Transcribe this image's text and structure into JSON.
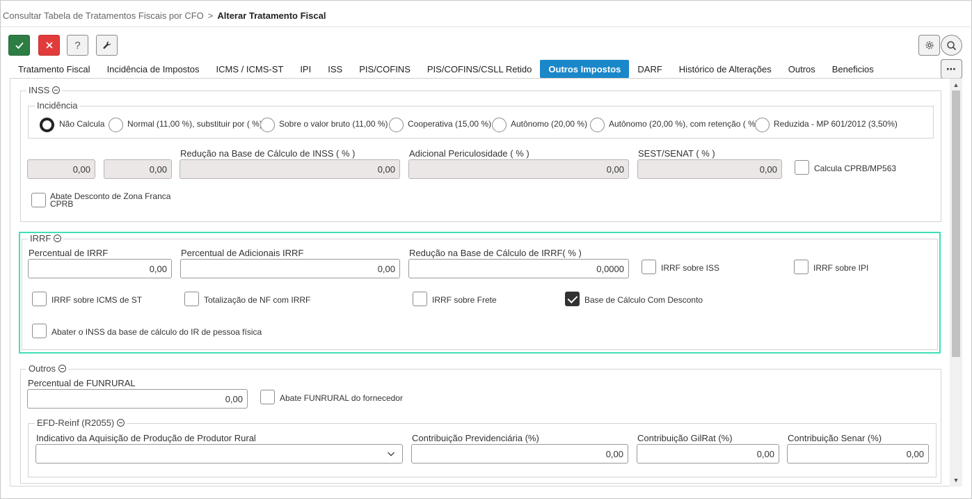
{
  "breadcrumb": {
    "parent": "Consultar Tabela de Tratamentos Fiscais por CFO",
    "separator": ">",
    "current": "Alterar Tratamento Fiscal"
  },
  "toolbar": {
    "help_label": "?",
    "more_label": "⋯"
  },
  "tabs": [
    {
      "label": "Tratamento Fiscal"
    },
    {
      "label": "Incidência de Impostos"
    },
    {
      "label": "ICMS / ICMS-ST"
    },
    {
      "label": "IPI"
    },
    {
      "label": "ISS"
    },
    {
      "label": "PIS/COFINS"
    },
    {
      "label": "PIS/COFINS/CSLL Retido"
    },
    {
      "label": "Outros Impostos",
      "active": true
    },
    {
      "label": "DARF"
    },
    {
      "label": "Histórico de Alterações"
    },
    {
      "label": "Outros"
    },
    {
      "label": "Beneficios"
    }
  ],
  "inss": {
    "legend": "INSS",
    "incidencia": {
      "legend": "Incidência",
      "options": [
        {
          "label": "Não Calcula",
          "selected": true
        },
        {
          "label": "Normal (11,00 %), substituir por ( %)"
        },
        {
          "label": "Sobre o valor bruto (11,00 %)"
        },
        {
          "label": "Cooperativa (15,00 %)"
        },
        {
          "label": "Autônomo (20,00 %)"
        },
        {
          "label": "Autônomo (20,00 %), com retenção ( %)"
        },
        {
          "label": "Reduzida - MP 601/2012 (3,50%)"
        }
      ]
    },
    "field1_value": "0,00",
    "field2_value": "0,00",
    "reducao_label": "Redução na Base de Cálculo de INSS ( % )",
    "reducao_value": "0,00",
    "adicional_label": "Adicional Periculosidade ( % )",
    "adicional_value": "0,00",
    "sest_label": "SEST/SENAT ( % )",
    "sest_value": "0,00",
    "calcula_cprb_label": "Calcula CPRB/MP563",
    "abate_zona_franca_line1": "Abate Desconto de Zona Franca",
    "abate_zona_franca_line2": "CPRB"
  },
  "irrf": {
    "legend": "IRRF",
    "percentual_label": "Percentual de IRRF",
    "percentual_value": "0,00",
    "adicionais_label": "Percentual de Adicionais IRRF",
    "adicionais_value": "0,00",
    "reducao_label": "Redução na Base de Cálculo de IRRF( % )",
    "reducao_value": "0,0000",
    "checkboxes": {
      "sobre_iss": {
        "label": "IRRF sobre ISS",
        "checked": false
      },
      "sobre_ipi": {
        "label": "IRRF sobre IPI",
        "checked": false
      },
      "sobre_icms_st": {
        "label": "IRRF sobre ICMS de ST",
        "checked": false
      },
      "totalizacao_nf": {
        "label": "Totalização de NF com IRRF",
        "checked": false
      },
      "sobre_frete": {
        "label": "IRRF sobre Frete",
        "checked": false
      },
      "base_desconto": {
        "label": "Base de Cálculo Com Desconto",
        "checked": true
      },
      "abater_inss": {
        "label": "Abater o INSS da base de cálculo do IR de pessoa física",
        "checked": false
      }
    }
  },
  "outros": {
    "legend": "Outros",
    "funrural_label": "Percentual de FUNRURAL",
    "funrural_value": "0,00",
    "abate_funrural_label": "Abate FUNRURAL do fornecedor",
    "efd": {
      "legend": "EFD-Reinf (R2055)",
      "indicativo_label": "Indicativo da Aquisição de Produção de Produtor Rural",
      "indicativo_value": "",
      "previdenciaria_label": "Contribuição Previdenciária (%)",
      "previdenciaria_value": "0,00",
      "gilrat_label": "Contribuição GilRat (%)",
      "gilrat_value": "0,00",
      "senar_label": "Contribuição Senar (%)",
      "senar_value": "0,00"
    }
  },
  "colors": {
    "ok_button": "#2e7d44",
    "cancel_button": "#e23b3b",
    "active_tab": "#1a87c9",
    "highlight_border": "#3fe0b4"
  }
}
